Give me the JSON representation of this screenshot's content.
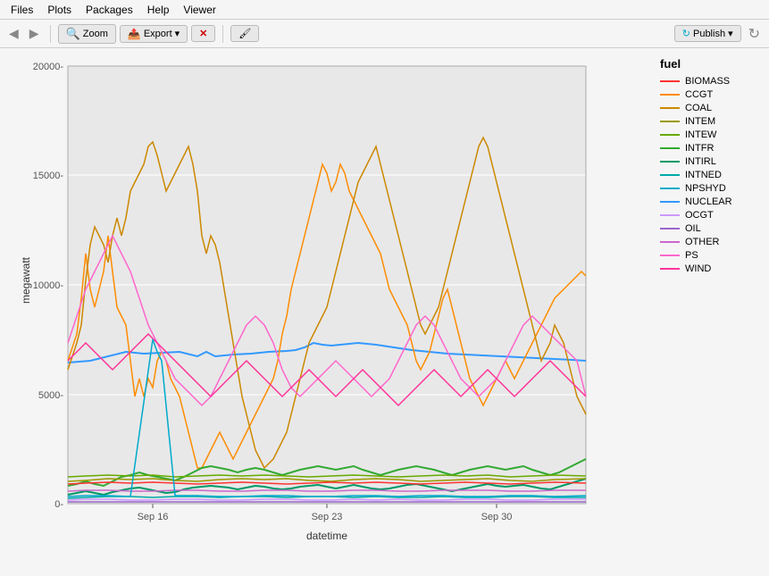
{
  "menubar": {
    "items": [
      "Files",
      "Plots",
      "Packages",
      "Help",
      "Viewer"
    ]
  },
  "toolbar": {
    "nav_back": "◀",
    "nav_forward": "▶",
    "zoom_label": "Zoom",
    "export_label": "Export",
    "export_arrow": "▾",
    "clear_label": "✕",
    "brush_label": "🖌",
    "publish_label": "Publish",
    "publish_arrow": "▾",
    "refresh_label": "↻"
  },
  "chart": {
    "y_axis_label": "megawatt",
    "x_axis_label": "datetime",
    "x_ticks": [
      "Sep 16",
      "Sep 23",
      "Sep 30"
    ],
    "y_ticks": [
      "0-",
      "5000-",
      "10000-",
      "15000-",
      "20000-"
    ],
    "title": ""
  },
  "legend": {
    "title": "fuel",
    "items": [
      {
        "label": "BIOMASS",
        "color": "#FF3333"
      },
      {
        "label": "CCGT",
        "color": "#FF8C00"
      },
      {
        "label": "COAL",
        "color": "#CC8800"
      },
      {
        "label": "INTEM",
        "color": "#999900"
      },
      {
        "label": "INTEW",
        "color": "#66AA00"
      },
      {
        "label": "INTFR",
        "color": "#33AA33"
      },
      {
        "label": "INTIRL",
        "color": "#009966"
      },
      {
        "label": "INTNED",
        "color": "#00AAAA"
      },
      {
        "label": "NPSHYD",
        "color": "#00AACC"
      },
      {
        "label": "NUCLEAR",
        "color": "#3399FF"
      },
      {
        "label": "OCGT",
        "color": "#CC99FF"
      },
      {
        "label": "OIL",
        "color": "#9966CC"
      },
      {
        "label": "OTHER",
        "color": "#CC66CC"
      },
      {
        "label": "PS",
        "color": "#FF66CC"
      },
      {
        "label": "WIND",
        "color": "#FF3399"
      }
    ]
  }
}
